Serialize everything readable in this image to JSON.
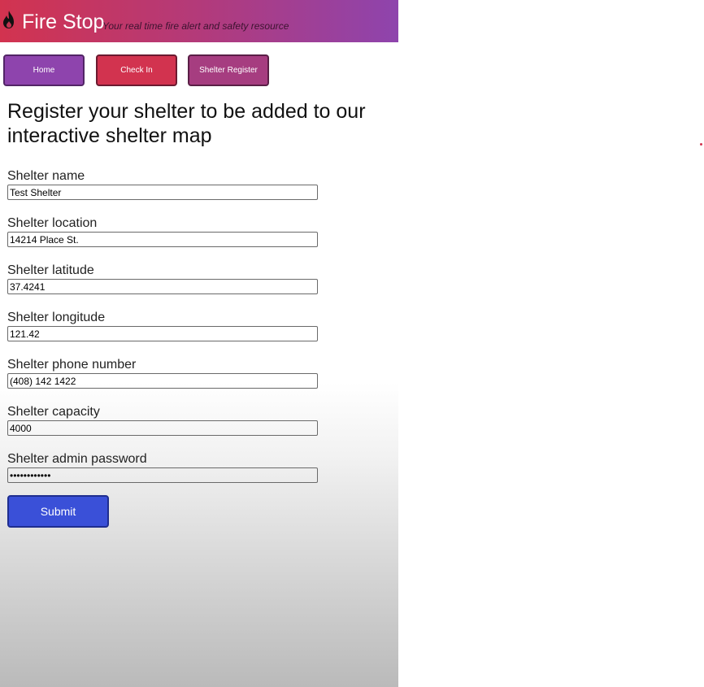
{
  "brand": {
    "title": "Fire Stop",
    "tagline": "Your real time fire alert and safety resource",
    "logo_icon": "flame-icon"
  },
  "nav": {
    "home_label": "Home",
    "checkin_label": "Check In",
    "shelter_register_label": "Shelter Register"
  },
  "main": {
    "heading": "Register your shelter to be added to our interactive shelter map"
  },
  "form": {
    "fields": [
      {
        "label": "Shelter name",
        "value": "Test Shelter"
      },
      {
        "label": "Shelter location",
        "value": "14214 Place St."
      },
      {
        "label": "Shelter latitude",
        "value": "37.4241"
      },
      {
        "label": "Shelter longitude",
        "value": "121.42"
      },
      {
        "label": "Shelter phone number",
        "value": "(408) 142 1422"
      },
      {
        "label": "Shelter capacity",
        "value": "4000"
      },
      {
        "label": "Shelter admin password",
        "value": "••••••••••••"
      }
    ],
    "submit_label": "Submit"
  },
  "colors": {
    "header_start": "#d2334f",
    "header_end": "#8e44ad",
    "home_button": "#8e44ad",
    "checkin_button": "#d2334f",
    "shelter_button": "#a63d80",
    "submit_button": "#3a50d8"
  }
}
